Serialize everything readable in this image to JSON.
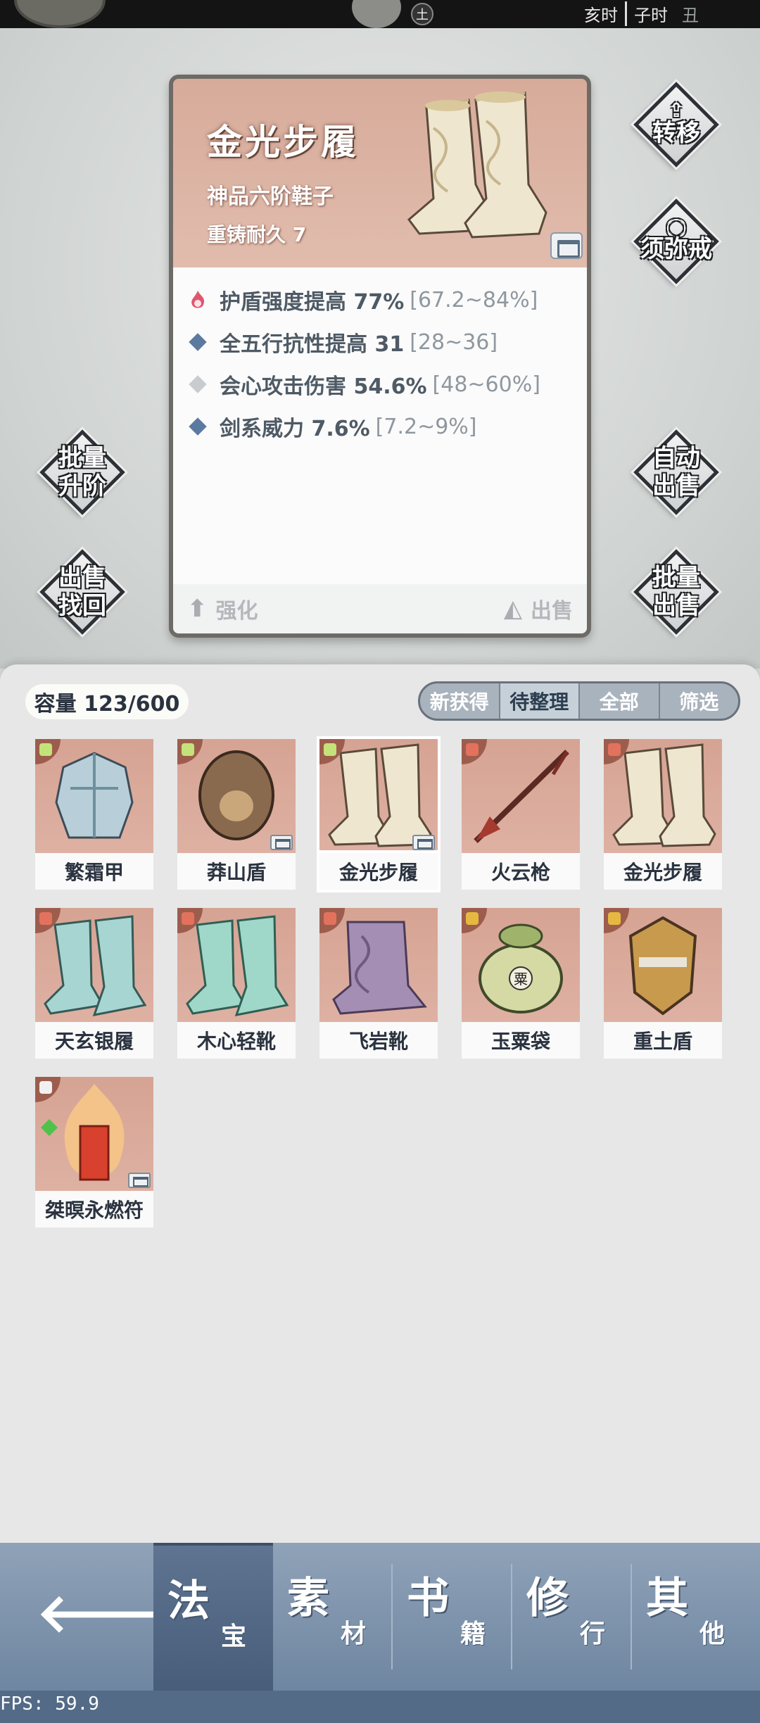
{
  "status": {
    "element_badge": "土",
    "times": [
      "亥时",
      "子时",
      "丑"
    ]
  },
  "item": {
    "name": "金光步履",
    "grade": "神品六阶鞋子",
    "durability": "重铸耐久 7",
    "stats": [
      {
        "icon": "flame-icon",
        "text": "护盾强度提高 77%",
        "range": "[67.2~84%]"
      },
      {
        "icon": "blue-diamond-icon",
        "text": "全五行抗性提高 31",
        "range": "[28~36]"
      },
      {
        "icon": "grey-diamond-icon",
        "text": "会心攻击伤害 54.6%",
        "range": "[48~60%]"
      },
      {
        "icon": "blue-diamond-icon",
        "text": "剑系威力 7.6%",
        "range": "[7.2~9%]"
      }
    ],
    "enhance_label": "强化",
    "sell_label": "出售"
  },
  "side_buttons": {
    "transfer": "转移",
    "xumi_ring": "须弥戒",
    "batch_upgrade": "批量升阶",
    "auto_sell": "自动出售",
    "sell_recover": "出售找回",
    "batch_sell": "批量出售"
  },
  "inventory": {
    "capacity": "容量 123/600",
    "filters": [
      "新获得",
      "待整理",
      "全部",
      "筛选"
    ],
    "active_filter": "待整理",
    "items": [
      {
        "name": "繁霜甲",
        "chest": false
      },
      {
        "name": "莽山盾",
        "chest": true
      },
      {
        "name": "金光步履",
        "chest": true,
        "selected": true
      },
      {
        "name": "火云枪",
        "chest": false
      },
      {
        "name": "金光步履",
        "chest": false
      },
      {
        "name": "天玄银履",
        "chest": false
      },
      {
        "name": "木心轻靴",
        "chest": false
      },
      {
        "name": "飞岩靴",
        "chest": false
      },
      {
        "name": "玉粟袋",
        "chest": false
      },
      {
        "name": "重土盾",
        "chest": false
      },
      {
        "name": "桀暝永燃符",
        "chest": true
      }
    ]
  },
  "nav": {
    "tabs": [
      {
        "big": "法",
        "small": "宝"
      },
      {
        "big": "素",
        "small": "材"
      },
      {
        "big": "书",
        "small": "籍"
      },
      {
        "big": "修",
        "small": "行"
      },
      {
        "big": "其",
        "small": "他"
      }
    ]
  },
  "fps": "FPS: 59.9",
  "colors": {
    "card_header": "#d7ab9a",
    "item_bg": "#d6a393",
    "nav_bg": "#7f94ad",
    "stat_flame": "#e0566e",
    "stat_blue": "#5b7aa0"
  }
}
